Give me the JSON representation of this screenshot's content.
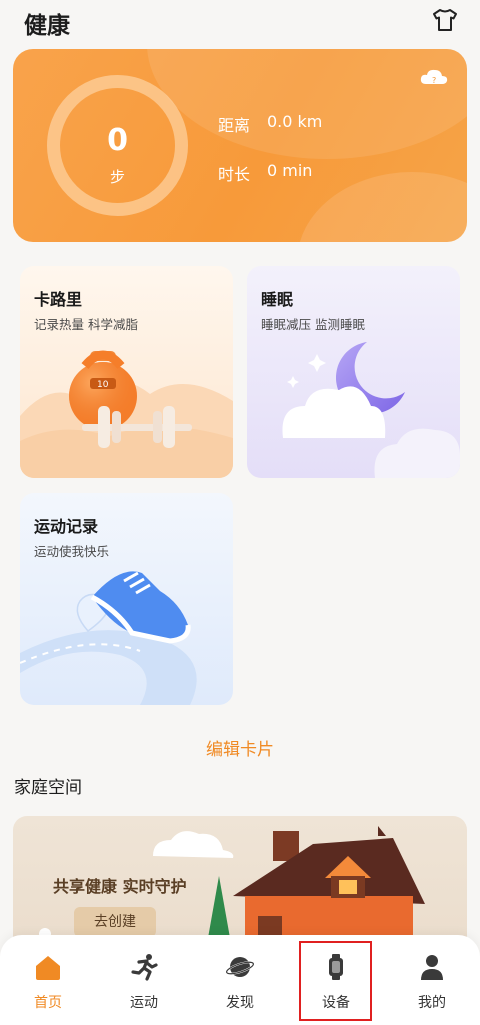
{
  "header": {
    "title": "健康",
    "wardrobe_icon": "tshirt-icon"
  },
  "steps_card": {
    "steps_value": "0",
    "steps_unit": "步",
    "distance_label": "距离",
    "distance_value": "0.0 km",
    "duration_label": "时长",
    "duration_value": "0 min",
    "weather_icon": "cloud-icon"
  },
  "cards": {
    "calorie": {
      "title": "卡路里",
      "subtitle": "记录热量 科学减脂",
      "kettlebell_label": "10"
    },
    "sleep": {
      "title": "睡眠",
      "subtitle": "睡眠减压 监测睡眠"
    },
    "sport": {
      "title": "运动记录",
      "subtitle": "运动使我快乐"
    }
  },
  "edit_cards_label": "编辑卡片",
  "family": {
    "section_title": "家庭空间",
    "banner_text": "共享健康 实时守护",
    "create_button": "去创建"
  },
  "bottom_nav": [
    {
      "label": "首页",
      "icon": "home-icon",
      "active": true
    },
    {
      "label": "运动",
      "icon": "running-icon",
      "active": false
    },
    {
      "label": "发现",
      "icon": "planet-icon",
      "active": false
    },
    {
      "label": "设备",
      "icon": "watch-icon",
      "active": false
    },
    {
      "label": "我的",
      "icon": "person-icon",
      "active": false
    }
  ],
  "colors": {
    "accent": "#f08a24",
    "step_card": "#f79a3a",
    "highlight": "#e02020"
  }
}
